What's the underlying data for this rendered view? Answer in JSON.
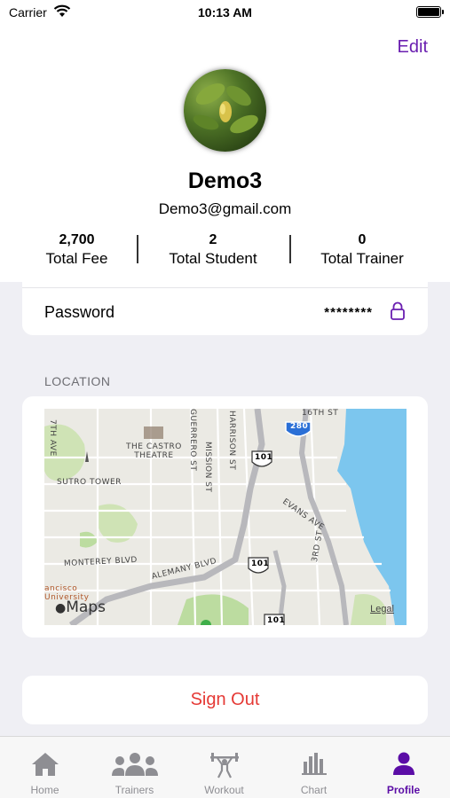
{
  "status_bar": {
    "carrier": "Carrier",
    "time": "10:13 AM"
  },
  "header": {
    "edit_label": "Edit"
  },
  "profile": {
    "name": "Demo3",
    "email": "Demo3@gmail.com"
  },
  "stats": [
    {
      "value": "2,700",
      "label": "Total Fee"
    },
    {
      "value": "2",
      "label": "Total Student"
    },
    {
      "value": "0",
      "label": "Total Trainer"
    }
  ],
  "password": {
    "label": "Password",
    "value": "********"
  },
  "location": {
    "section_title": "LOCATION",
    "map_labels": {
      "the_castro_theatre": "THE CASTRO\nTHEATRE",
      "sutro_tower": "SUTRO TOWER",
      "monterey_blvd": "MONTEREY BLVD",
      "alemany_blvd": "ALEMANY BLVD",
      "evans_ave": "EVANS AVE",
      "third_st": "3RD ST",
      "sixteenth_st": "16TH ST",
      "guerrero_st": "GUERRERO ST",
      "mission_st": "MISSION ST",
      "harrison_st": "HARRISON ST",
      "seventh_ave": "7TH AVE",
      "univ": "ancisco\nUniversity",
      "hwy_101": "101",
      "hwy_280": "280"
    },
    "maps_brand": "Maps",
    "legal": "Legal"
  },
  "sign_out_label": "Sign Out",
  "tabs": [
    {
      "label": "Home",
      "icon": "home-icon"
    },
    {
      "label": "Trainers",
      "icon": "people-icon"
    },
    {
      "label": "Workout",
      "icon": "weightlifter-icon"
    },
    {
      "label": "Chart",
      "icon": "bar-chart-icon"
    },
    {
      "label": "Profile",
      "icon": "person-icon",
      "active": true
    }
  ],
  "colors": {
    "accent": "#5b0da6",
    "danger": "#e53935",
    "background": "#efeff4"
  }
}
